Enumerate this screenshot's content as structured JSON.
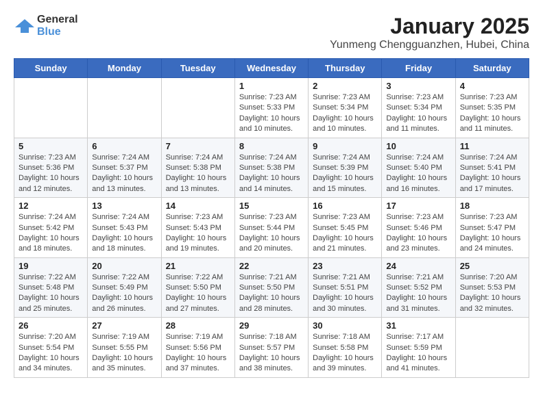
{
  "header": {
    "logo_general": "General",
    "logo_blue": "Blue",
    "title": "January 2025",
    "subtitle": "Yunmeng Chengguanzhen, Hubei, China"
  },
  "days_of_week": [
    "Sunday",
    "Monday",
    "Tuesday",
    "Wednesday",
    "Thursday",
    "Friday",
    "Saturday"
  ],
  "weeks": [
    [
      {
        "day": "",
        "info": ""
      },
      {
        "day": "",
        "info": ""
      },
      {
        "day": "",
        "info": ""
      },
      {
        "day": "1",
        "info": "Sunrise: 7:23 AM\nSunset: 5:33 PM\nDaylight: 10 hours\nand 10 minutes."
      },
      {
        "day": "2",
        "info": "Sunrise: 7:23 AM\nSunset: 5:34 PM\nDaylight: 10 hours\nand 10 minutes."
      },
      {
        "day": "3",
        "info": "Sunrise: 7:23 AM\nSunset: 5:34 PM\nDaylight: 10 hours\nand 11 minutes."
      },
      {
        "day": "4",
        "info": "Sunrise: 7:23 AM\nSunset: 5:35 PM\nDaylight: 10 hours\nand 11 minutes."
      }
    ],
    [
      {
        "day": "5",
        "info": "Sunrise: 7:23 AM\nSunset: 5:36 PM\nDaylight: 10 hours\nand 12 minutes."
      },
      {
        "day": "6",
        "info": "Sunrise: 7:24 AM\nSunset: 5:37 PM\nDaylight: 10 hours\nand 13 minutes."
      },
      {
        "day": "7",
        "info": "Sunrise: 7:24 AM\nSunset: 5:38 PM\nDaylight: 10 hours\nand 13 minutes."
      },
      {
        "day": "8",
        "info": "Sunrise: 7:24 AM\nSunset: 5:38 PM\nDaylight: 10 hours\nand 14 minutes."
      },
      {
        "day": "9",
        "info": "Sunrise: 7:24 AM\nSunset: 5:39 PM\nDaylight: 10 hours\nand 15 minutes."
      },
      {
        "day": "10",
        "info": "Sunrise: 7:24 AM\nSunset: 5:40 PM\nDaylight: 10 hours\nand 16 minutes."
      },
      {
        "day": "11",
        "info": "Sunrise: 7:24 AM\nSunset: 5:41 PM\nDaylight: 10 hours\nand 17 minutes."
      }
    ],
    [
      {
        "day": "12",
        "info": "Sunrise: 7:24 AM\nSunset: 5:42 PM\nDaylight: 10 hours\nand 18 minutes."
      },
      {
        "day": "13",
        "info": "Sunrise: 7:24 AM\nSunset: 5:43 PM\nDaylight: 10 hours\nand 18 minutes."
      },
      {
        "day": "14",
        "info": "Sunrise: 7:23 AM\nSunset: 5:43 PM\nDaylight: 10 hours\nand 19 minutes."
      },
      {
        "day": "15",
        "info": "Sunrise: 7:23 AM\nSunset: 5:44 PM\nDaylight: 10 hours\nand 20 minutes."
      },
      {
        "day": "16",
        "info": "Sunrise: 7:23 AM\nSunset: 5:45 PM\nDaylight: 10 hours\nand 21 minutes."
      },
      {
        "day": "17",
        "info": "Sunrise: 7:23 AM\nSunset: 5:46 PM\nDaylight: 10 hours\nand 23 minutes."
      },
      {
        "day": "18",
        "info": "Sunrise: 7:23 AM\nSunset: 5:47 PM\nDaylight: 10 hours\nand 24 minutes."
      }
    ],
    [
      {
        "day": "19",
        "info": "Sunrise: 7:22 AM\nSunset: 5:48 PM\nDaylight: 10 hours\nand 25 minutes."
      },
      {
        "day": "20",
        "info": "Sunrise: 7:22 AM\nSunset: 5:49 PM\nDaylight: 10 hours\nand 26 minutes."
      },
      {
        "day": "21",
        "info": "Sunrise: 7:22 AM\nSunset: 5:50 PM\nDaylight: 10 hours\nand 27 minutes."
      },
      {
        "day": "22",
        "info": "Sunrise: 7:21 AM\nSunset: 5:50 PM\nDaylight: 10 hours\nand 28 minutes."
      },
      {
        "day": "23",
        "info": "Sunrise: 7:21 AM\nSunset: 5:51 PM\nDaylight: 10 hours\nand 30 minutes."
      },
      {
        "day": "24",
        "info": "Sunrise: 7:21 AM\nSunset: 5:52 PM\nDaylight: 10 hours\nand 31 minutes."
      },
      {
        "day": "25",
        "info": "Sunrise: 7:20 AM\nSunset: 5:53 PM\nDaylight: 10 hours\nand 32 minutes."
      }
    ],
    [
      {
        "day": "26",
        "info": "Sunrise: 7:20 AM\nSunset: 5:54 PM\nDaylight: 10 hours\nand 34 minutes."
      },
      {
        "day": "27",
        "info": "Sunrise: 7:19 AM\nSunset: 5:55 PM\nDaylight: 10 hours\nand 35 minutes."
      },
      {
        "day": "28",
        "info": "Sunrise: 7:19 AM\nSunset: 5:56 PM\nDaylight: 10 hours\nand 37 minutes."
      },
      {
        "day": "29",
        "info": "Sunrise: 7:18 AM\nSunset: 5:57 PM\nDaylight: 10 hours\nand 38 minutes."
      },
      {
        "day": "30",
        "info": "Sunrise: 7:18 AM\nSunset: 5:58 PM\nDaylight: 10 hours\nand 39 minutes."
      },
      {
        "day": "31",
        "info": "Sunrise: 7:17 AM\nSunset: 5:59 PM\nDaylight: 10 hours\nand 41 minutes."
      },
      {
        "day": "",
        "info": ""
      }
    ]
  ]
}
